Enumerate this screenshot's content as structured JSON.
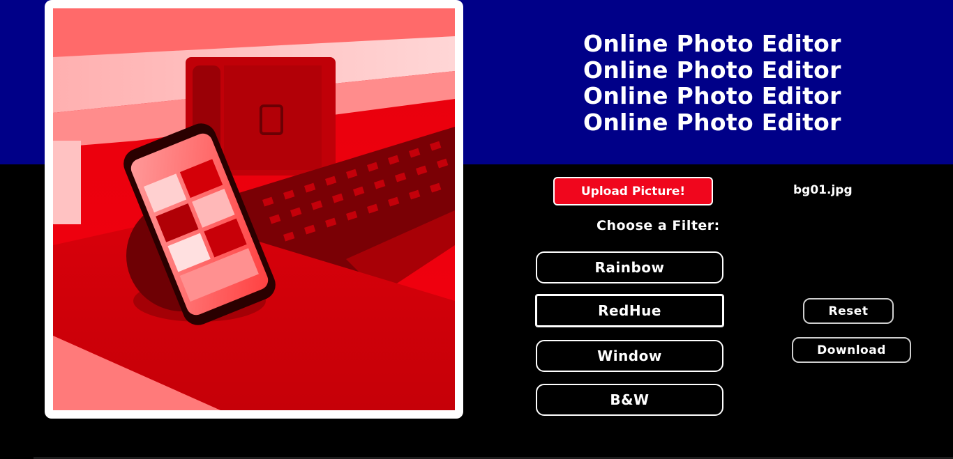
{
  "colors": {
    "header_band": "#000088",
    "background": "#000000",
    "upload_button": "#f0061d",
    "photo_tint": "#e0000a"
  },
  "header": {
    "title_lines": [
      "Online Photo Editor",
      "Online Photo Editor",
      "Online Photo Editor",
      "Online Photo Editor"
    ]
  },
  "upload": {
    "button_label": "Upload Picture!",
    "filename": "bg01.jpg"
  },
  "filters": {
    "heading": "Choose a Filter:",
    "options": [
      "Rainbow",
      "RedHue",
      "Window",
      "B&W"
    ],
    "selected": "RedHue"
  },
  "actions": {
    "reset_label": "Reset",
    "download_label": "Download"
  },
  "preview": {
    "icon": "photo-preview-red-hue"
  }
}
